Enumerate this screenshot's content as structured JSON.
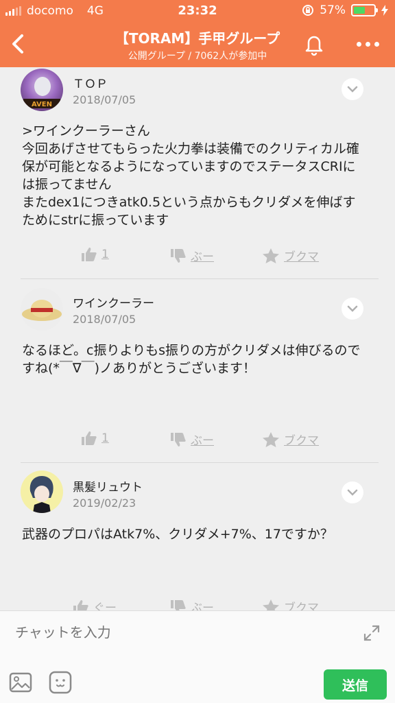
{
  "status_bar": {
    "carrier": "docomo",
    "network": "4G",
    "time": "23:32",
    "battery": "57%",
    "battery_level": 0.57
  },
  "header": {
    "title": "【TORAM】手甲グループ",
    "subtitle": "公開グループ / 7062人が参加中"
  },
  "posts": [
    {
      "author": "ＴＯＰ",
      "date": "2018/07/05",
      "text": ">ワインクーラーさん\n今回あげさせてもらった火力拳は装備でのクリティカル確保が可能となるようになっていますのでステータスCRIには振ってません\nまたdex1につきatk0.5という点からもクリダメを伸ばすためにstrに振っています",
      "like_count": "1",
      "boo_label": "ぶー",
      "bookmark_label": "ブクマ"
    },
    {
      "author": "ワインクーラー",
      "date": "2018/07/05",
      "text": "なるほど。c振りよりもs振りの方がクリダメは伸びるのですね(*￣∇￣)ノありがとうございます！",
      "like_count": "1",
      "boo_label": "ぶー",
      "bookmark_label": "ブクマ"
    },
    {
      "author": "黒髪リュウト",
      "date": "2019/02/23",
      "text": "武器のプロパはAtk7%、クリダメ+7%、17ですか？",
      "like_count": "ぐー",
      "boo_label": "ぶー",
      "bookmark_label": "ブクマ"
    }
  ],
  "composer": {
    "placeholder": "チャットを入力",
    "send_label": "送信"
  },
  "colors": {
    "accent": "#f47b4b",
    "send": "#2fbf5a",
    "muted": "#b3b3b3"
  }
}
